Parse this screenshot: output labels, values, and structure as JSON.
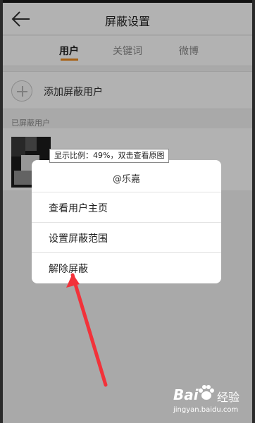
{
  "header": {
    "title": "屏蔽设置",
    "back_icon": "back-arrow-icon"
  },
  "tabs": [
    {
      "label": "用户",
      "active": true
    },
    {
      "label": "关键词",
      "active": false
    },
    {
      "label": "微博",
      "active": false
    }
  ],
  "accent_color": "#f08c1e",
  "add_user": {
    "label": "添加屏蔽用户",
    "icon": "plus-icon"
  },
  "blocked_section": {
    "label": "已屏蔽用户"
  },
  "tooltip": {
    "text": "显示比例：49%，双击查看原图"
  },
  "dialog": {
    "title": "@乐嘉",
    "items": [
      {
        "label": "查看用户主页"
      },
      {
        "label": "设置屏蔽范围"
      },
      {
        "label": "解除屏蔽"
      }
    ]
  },
  "annotation": {
    "arrow_color": "#f2323a"
  },
  "watermark": {
    "brand": "Bai",
    "paw_icon": "baidu-paw-icon",
    "suffix": "经验",
    "url": "jingyan.baidu.com"
  }
}
